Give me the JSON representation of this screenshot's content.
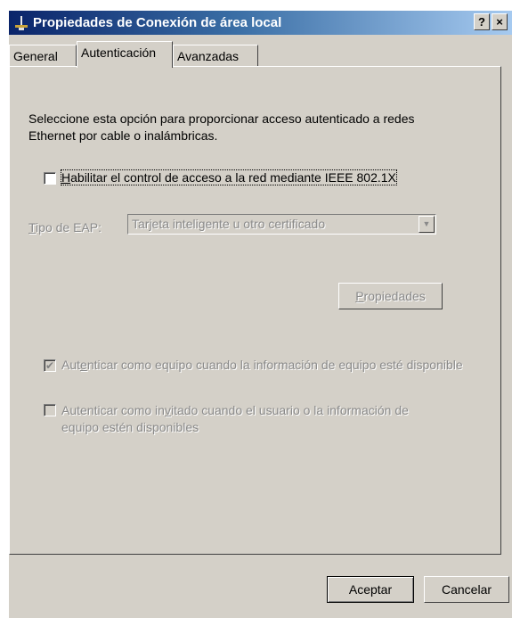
{
  "window": {
    "title": "Propiedades de Conexión de área local",
    "help_label": "?",
    "close_label": "×"
  },
  "tabs": [
    {
      "label": "General",
      "active": false
    },
    {
      "label": "Autenticación",
      "active": true
    },
    {
      "label": "Avanzadas",
      "active": false
    }
  ],
  "auth": {
    "description": "Seleccione esta opción para proporcionar acceso autenticado a redes Ethernet por cable o inalámbricas.",
    "enable_8021x": {
      "label_first": "H",
      "label_rest": "abilitar el control de acceso a la red mediante IEEE 802.1X",
      "checked": false
    },
    "eap_type": {
      "label_first": "T",
      "label_rest": "ipo de EAP:",
      "value": "Tarjeta inteligente u otro certificado"
    },
    "properties_button": {
      "label_first": "P",
      "label_rest": "ropiedades"
    },
    "auth_as_computer": {
      "label_pre": "Aut",
      "label_u": "e",
      "label_post": "nticar como equipo cuando la información de equipo esté disponible",
      "checked": true
    },
    "auth_as_guest": {
      "label_line1_pre": "Autenticar como in",
      "label_u": "v",
      "label_line1_post": "itado cuando el usuario o la información de",
      "label_line2": "equipo estén disponibles",
      "checked": false
    }
  },
  "footer": {
    "ok_label": "Aceptar",
    "cancel_label": "Cancelar"
  }
}
